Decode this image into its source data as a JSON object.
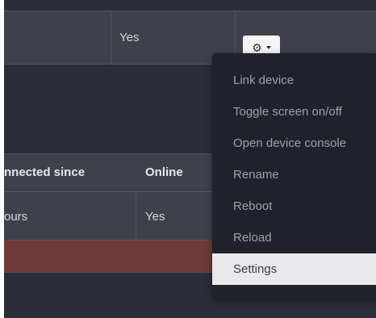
{
  "top_row": {
    "online_value": "Yes",
    "actions_icon": "gear-icon",
    "actions_caret_icon": "caret-down-icon"
  },
  "table": {
    "headers": {
      "connected_since": "nnected since",
      "online": "Online"
    },
    "rows": [
      {
        "connected_since": "ours",
        "online": "Yes"
      }
    ]
  },
  "dropdown": {
    "items": [
      {
        "label": "Link device"
      },
      {
        "label": "Toggle screen on/off"
      },
      {
        "label": "Open device console"
      },
      {
        "label": "Rename"
      },
      {
        "label": "Reboot"
      },
      {
        "label": "Reload"
      },
      {
        "label": "Settings",
        "highlighted": true
      }
    ]
  },
  "colors": {
    "background": "#2b2e37",
    "row": "#3e414a",
    "error_row": "#6e3a37",
    "menu": "#20212a",
    "menu_highlight": "#e9e9eb"
  }
}
